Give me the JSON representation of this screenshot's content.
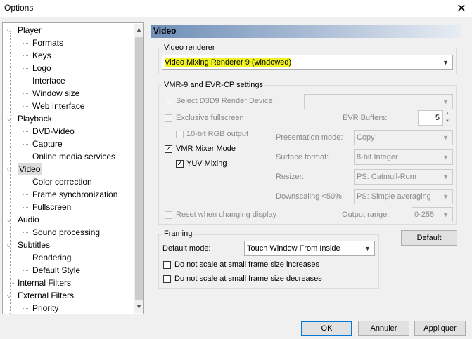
{
  "window": {
    "title": "Options",
    "close_glyph": "✕"
  },
  "tree": {
    "items": [
      {
        "label": "Player",
        "level": 0,
        "expanded": true
      },
      {
        "label": "Formats",
        "level": 1
      },
      {
        "label": "Keys",
        "level": 1
      },
      {
        "label": "Logo",
        "level": 1
      },
      {
        "label": "Interface",
        "level": 1
      },
      {
        "label": "Window size",
        "level": 1
      },
      {
        "label": "Web Interface",
        "level": 1
      },
      {
        "label": "Playback",
        "level": 0,
        "expanded": true
      },
      {
        "label": "DVD-Video",
        "level": 1
      },
      {
        "label": "Capture",
        "level": 1
      },
      {
        "label": "Online media services",
        "level": 1
      },
      {
        "label": "Video",
        "level": 0,
        "expanded": true,
        "selected": true
      },
      {
        "label": "Color correction",
        "level": 1
      },
      {
        "label": "Frame synchronization",
        "level": 1
      },
      {
        "label": "Fullscreen",
        "level": 1
      },
      {
        "label": "Audio",
        "level": 0,
        "expanded": true
      },
      {
        "label": "Sound processing",
        "level": 1
      },
      {
        "label": "Subtitles",
        "level": 0,
        "expanded": true
      },
      {
        "label": "Rendering",
        "level": 1
      },
      {
        "label": "Default Style",
        "level": 1
      },
      {
        "label": "Internal Filters",
        "level": 0
      },
      {
        "label": "External Filters",
        "level": 0,
        "expanded": true
      },
      {
        "label": "Priority",
        "level": 1
      }
    ]
  },
  "page": {
    "heading": "Video",
    "renderer_group": {
      "label": "Video renderer",
      "value": "Video Mixing Renderer 9 (windowed)"
    },
    "vmr_group": {
      "label": "VMR-9 and EVR-CP settings",
      "select_d3d9": "Select D3D9 Render Device",
      "exclusive_fullscreen": "Exclusive fullscreen",
      "rgb_10bit": "10-bit RGB output",
      "vmr_mixer": "VMR Mixer Mode",
      "yuv_mixing": "YUV Mixing",
      "reset_on_change": "Reset when changing display",
      "evr_buffers_label": "EVR Buffers:",
      "evr_buffers_value": "5",
      "presentation_label": "Presentation mode:",
      "presentation_value": "Copy",
      "surface_label": "Surface format:",
      "surface_value": "8-bit Integer",
      "resizer_label": "Resizer:",
      "resizer_value": "PS: Catmull-Rom",
      "downscaling_label": "Downscaling <50%:",
      "downscaling_value": "PS: Simple averaging",
      "output_range_label": "Output range:",
      "output_range_value": "0-255"
    },
    "framing_group": {
      "label": "Framing",
      "default_mode_label": "Default mode:",
      "default_mode_value": "Touch Window From Inside",
      "no_scale_increase": "Do not scale at small frame size increases",
      "no_scale_decrease": "Do not scale at small frame size decreases"
    },
    "default_button": "Default"
  },
  "footer": {
    "ok": "OK",
    "cancel": "Annuler",
    "apply": "Appliquer"
  },
  "colors": {
    "highlight": "#f0f321",
    "header_start": "#6f8fb7",
    "focus_border": "#0078d7"
  }
}
